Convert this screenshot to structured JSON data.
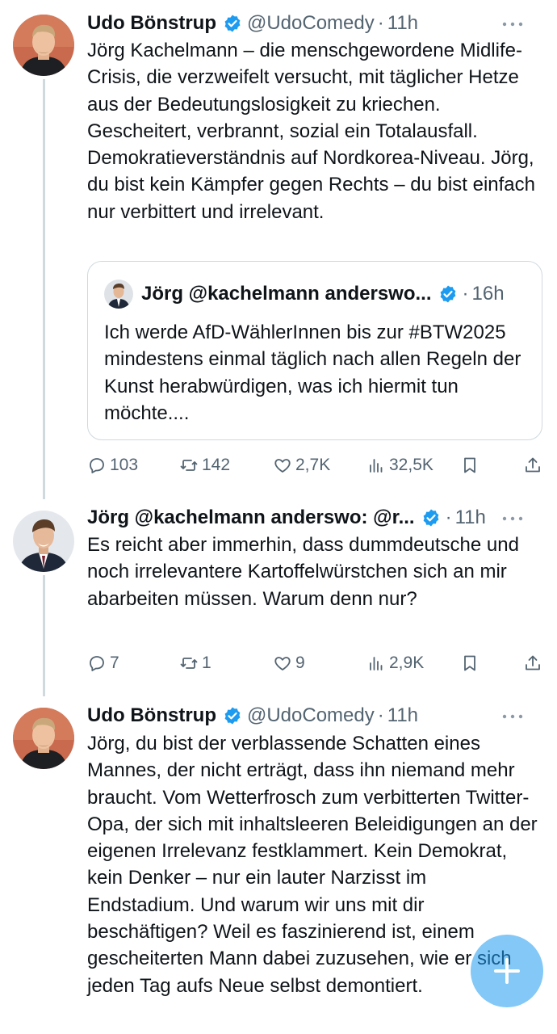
{
  "tweets": [
    {
      "name": "Udo Bönstrup",
      "handle": "@UdoComedy",
      "sep": "·",
      "time": "11h",
      "text": "Jörg Kachelmann – die menschgewordene Midlife-Crisis, die verzweifelt versucht, mit täglicher Hetze aus der Bedeutungslosigkeit zu kriechen. Gescheitert, verbrannt, sozial ein Totalausfall. Demokratieverständnis auf Nordkorea-Niveau. Jörg, du bist kein Kämpfer gegen Rechts – du bist einfach nur verbittert und irrelevant.",
      "quote": {
        "name": "Jörg @kachelmann anderswo...",
        "sep": "·",
        "time": "16h",
        "text": "Ich werde AfD-WählerInnen bis zur #BTW2025 mindestens einmal täglich nach allen Regeln der Kunst herabwürdigen, was ich hiermit tun möchte...."
      },
      "replies": "103",
      "reposts": "142",
      "likes": "2,7K",
      "views": "32,5K"
    },
    {
      "name": "Jörg @kachelmann anderswo: @r...",
      "sep": "·",
      "time": "11h",
      "text": "Es reicht aber immerhin, dass dummdeutsche und noch irrelevantere Kartoffelwürstchen sich an mir abarbeiten müssen. Warum denn nur?",
      "replies": "7",
      "reposts": "1",
      "likes": "9",
      "views": "2,9K"
    },
    {
      "name": "Udo Bönstrup",
      "handle": "@UdoComedy",
      "sep": "·",
      "time": "11h",
      "text": "Jörg, du bist der verblassende Schatten eines Mannes, der nicht erträgt, dass ihn niemand mehr braucht. Vom Wetterfrosch zum verbitterten Twitter-Opa, der sich mit inhaltsleeren Beleidigungen an der eigenen Irrelevanz festklammert. Kein Demokrat, kein Denker – nur ein lauter Narzisst im Endstadium. Und warum wir uns mit dir beschäftigen? Weil es faszinierend ist, einem gescheiterten Mann dabei zuzusehen, wie er sich jeden Tag aufs Neue selbst demontiert."
    }
  ],
  "icons": {
    "verified": "verified-badge-icon",
    "more": "more-icon",
    "reply": "reply-icon",
    "repost": "repost-icon",
    "like": "like-icon",
    "views": "views-icon",
    "bookmark": "bookmark-icon",
    "share": "share-icon",
    "compose": "compose-plus-icon"
  },
  "colors": {
    "accent": "#1d9bf0",
    "text": "#0f1419",
    "secondary": "#536471",
    "border": "#cfd9de"
  }
}
